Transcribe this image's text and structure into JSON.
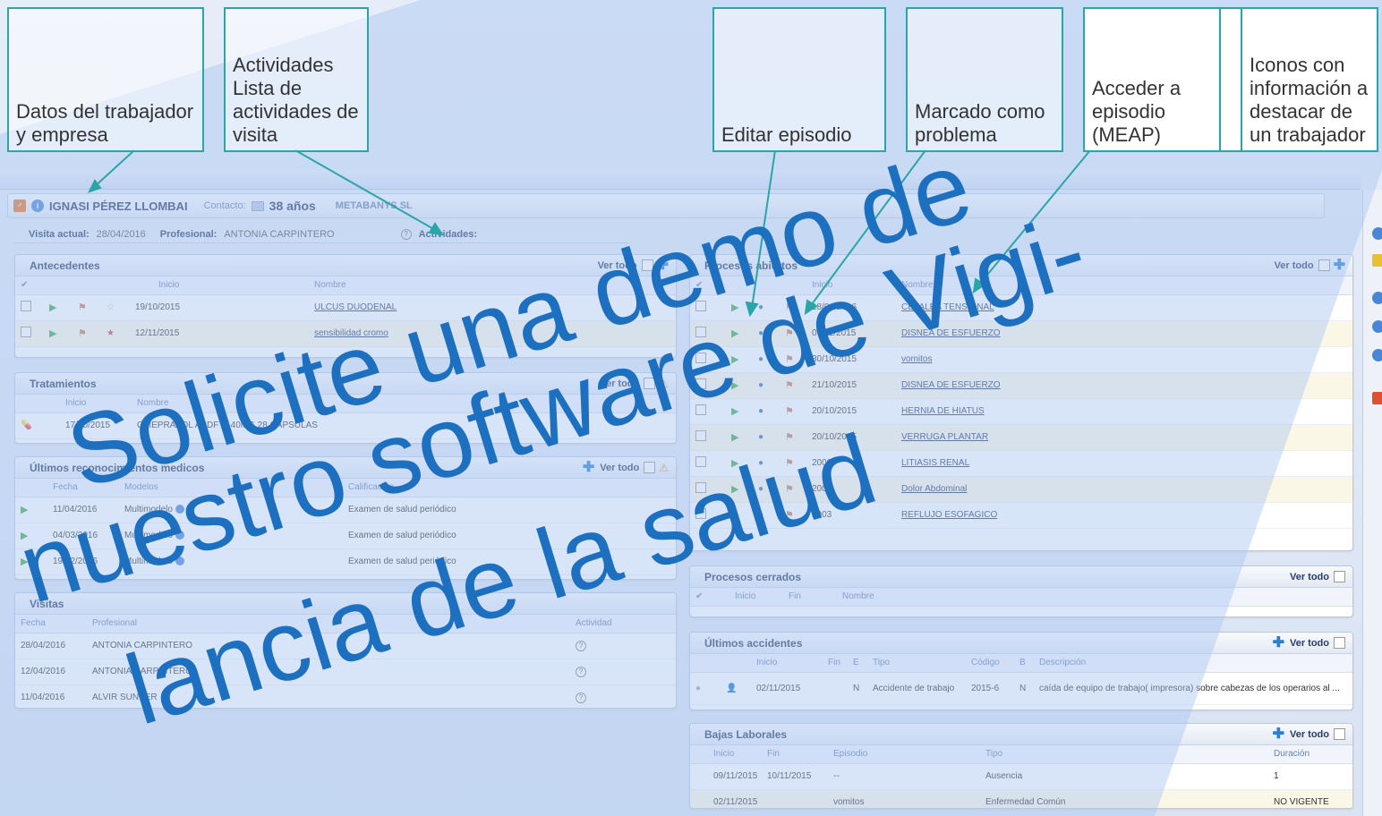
{
  "worker": {
    "name": "IGNASI PÉREZ LLOMBAI",
    "contact_label": "Contacto:",
    "age": "38 años",
    "company": "METABANYS SL",
    "gender_symbol": "♂",
    "info_symbol": "i"
  },
  "visit": {
    "current_label": "Visita actual:",
    "current_date": "28/04/2016",
    "professional_label": "Profesional:",
    "professional": "ANTONIA CARPINTERO",
    "activities_label": "Actividades:"
  },
  "common": {
    "ver_todo": "Ver todo"
  },
  "antecedentes": {
    "title": "Antecedentes",
    "headers": [
      "Inicio",
      "Nombre"
    ],
    "rows": [
      {
        "inicio": "19/10/2015",
        "nombre": "ULCUS DUODENAL"
      },
      {
        "inicio": "12/11/2015",
        "nombre": "sensibilidad cromo"
      }
    ]
  },
  "tratamientos": {
    "title": "Tratamientos",
    "headers": [
      "Inicio",
      "Nombre"
    ],
    "rows": [
      {
        "inicio": "17/10/2015",
        "nombre": "OMEPRAZOL ABDF G 40MG 28 CAPSULAS"
      }
    ]
  },
  "reconocimientos": {
    "title": "Últimos reconocimientos medicos",
    "headers": [
      "Fecha",
      "Modelos",
      "Calificación"
    ],
    "rows": [
      {
        "fecha": "11/04/2016",
        "modelo": "Multimodelo",
        "calif": "Examen de salud periódico"
      },
      {
        "fecha": "04/03/2016",
        "modelo": "Multimodelo",
        "calif": "Examen de salud periódico"
      },
      {
        "fecha": "19/02/2016",
        "modelo": "Multimodelo",
        "calif": "Examen de salud periódico"
      }
    ]
  },
  "visitas": {
    "title": "Visitas",
    "headers": [
      "Fecha",
      "Profesional",
      "Actividad"
    ],
    "rows": [
      {
        "fecha": "28/04/2016",
        "prof": "ANTONIA CARPINTERO"
      },
      {
        "fecha": "12/04/2016",
        "prof": "ANTONIA CARPINTERO"
      },
      {
        "fecha": "11/04/2016",
        "prof": "ALVIR SUNYER"
      }
    ]
  },
  "procesos_abiertos": {
    "title": "Procesos abiertos",
    "headers": [
      "Inicio",
      "Nombre"
    ],
    "rows": [
      {
        "inicio": "18/04/2016",
        "nombre": "CEFALEA TENSIONAL"
      },
      {
        "inicio": "07/11/2015",
        "nombre": "DISNEA DE ESFUERZO"
      },
      {
        "inicio": "30/10/2015",
        "nombre": "vomitos"
      },
      {
        "inicio": "21/10/2015",
        "nombre": "DISNEA DE ESFUERZO"
      },
      {
        "inicio": "20/10/2015",
        "nombre": "HERNIA DE HIATUS"
      },
      {
        "inicio": "20/10/2015",
        "nombre": "VERRUGA PLANTAR"
      },
      {
        "inicio": "2006",
        "nombre": "LITIASIS RENAL"
      },
      {
        "inicio": "2006",
        "nombre": "Dolor Abdominal"
      },
      {
        "inicio": "2003",
        "nombre": "REFLUJO ESOFAGICO"
      }
    ]
  },
  "procesos_cerrados": {
    "title": "Procesos cerrados",
    "headers": [
      "Inicio",
      "Fin",
      "Nombre"
    ]
  },
  "accidentes": {
    "title": "Últimos accidentes",
    "headers": [
      "Inicio",
      "Fin",
      "E",
      "Tipo",
      "Código",
      "B",
      "Descripción"
    ],
    "rows": [
      {
        "inicio": "02/11/2015",
        "fin": "",
        "e": "N",
        "tipo": "Accidente de trabajo",
        "codigo": "2015-6",
        "b": "N",
        "desc": "caída de equipo de trabajo( impresora) sobre cabezas de los operarios al ..."
      }
    ]
  },
  "bajas": {
    "title": "Bajas Laborales",
    "headers": [
      "Inicio",
      "Fin",
      "Episodio",
      "Tipo",
      "Duración"
    ],
    "rows": [
      {
        "inicio": "09/11/2015",
        "fin": "10/11/2015",
        "episodio": "--",
        "tipo": "Ausencia",
        "duracion": "1"
      },
      {
        "inicio": "02/11/2015",
        "fin": "",
        "episodio": "vomitos",
        "tipo": "Enfermedad Común",
        "duracion": "NO VIGENTE"
      }
    ]
  },
  "annotations": {
    "datos": "Datos del trabajador y empresa",
    "actividades": "Actividades Lista de actividades de visita",
    "editar": "Editar episodio",
    "marcado": "Marcado como problema",
    "acceder": "Acceder a episodio (MEAP)",
    "iconos": "Iconos con información a destacar de un trabajador"
  },
  "watermark": {
    "line1": "Solicite una demo de",
    "line2": "nuestro software de Vigi-",
    "line3": "lancia de la salud"
  }
}
